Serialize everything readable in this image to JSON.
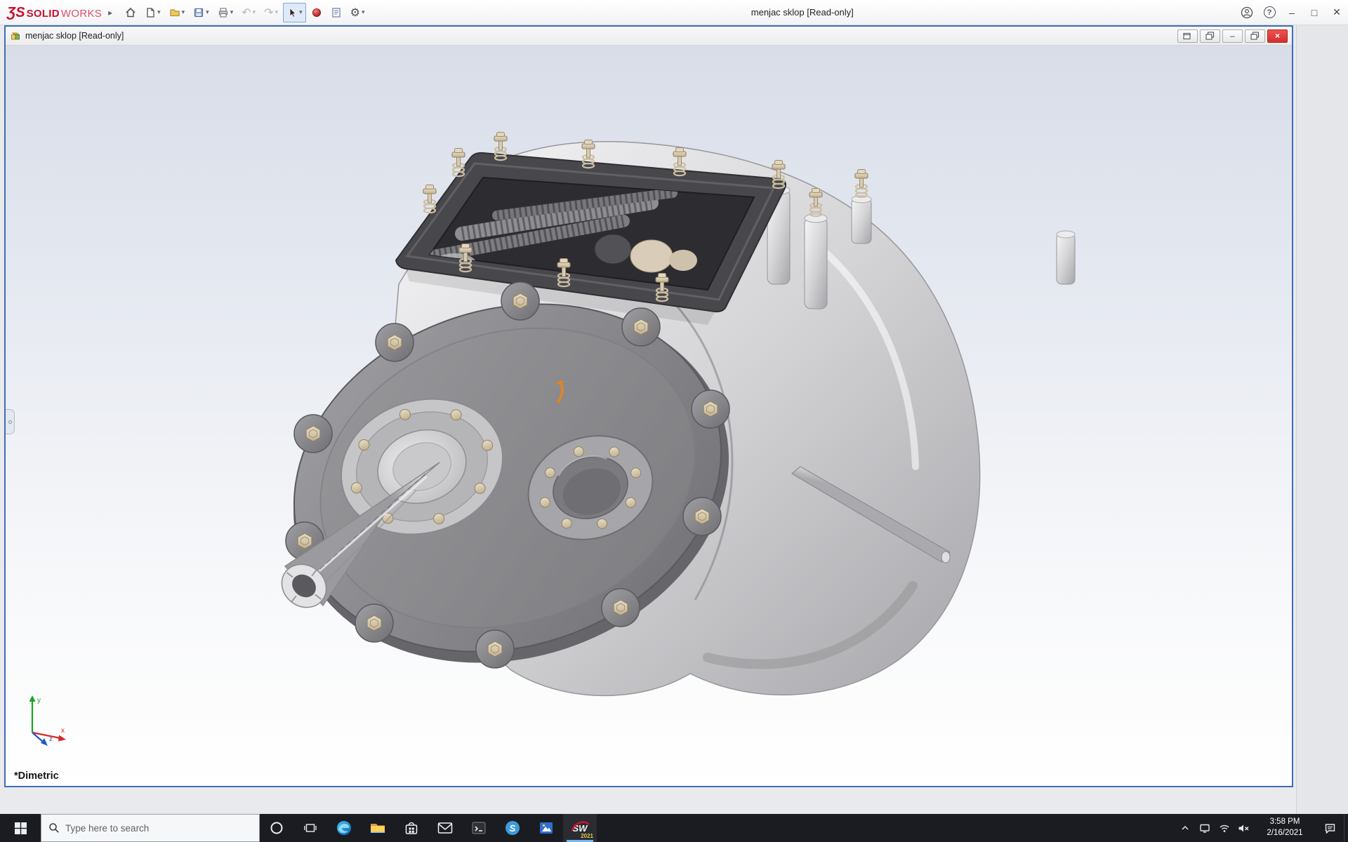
{
  "app_titlebar": {
    "logo_mark": "ƷS",
    "logo_solid": "SOLID",
    "logo_works": "WORKS",
    "title": "menjac sklop [Read-only]",
    "glyphs": {
      "expander": "▸",
      "caret": "▾",
      "undo": "↶",
      "redo": "↷",
      "gear": "⚙",
      "help": "?",
      "minimize": "–",
      "maximize": "□",
      "close": "×"
    }
  },
  "document_window": {
    "title": "menjac sklop [Read-only]",
    "glyphs": {
      "minimize": "–",
      "close": "×"
    }
  },
  "viewport": {
    "view_orientation_label": "*Dimetric",
    "triad": {
      "x_label": "x",
      "y_label": "y",
      "z_label": "z"
    }
  },
  "taskbar": {
    "search_placeholder": "Type here to search",
    "solidworks_icon_text": "SW",
    "solidworks_badge": "2021",
    "clock_time": "3:58 PM",
    "clock_date": "2/16/2021"
  },
  "colors": {
    "document_border_blue": "#3f6db5",
    "close_button_red": "#d32f2f",
    "viewport_gradient_top": "#d8dde8",
    "viewport_gradient_bottom": "#ffffff",
    "taskbar_background": "#1b1c22",
    "solidworks_logo_red": "#c8102e",
    "bolt_tan": "#d5c8ae",
    "flange_gray": "#8a8a8d",
    "gasket_dark_gray": "#48484c",
    "sketch_orange": "#e8821e",
    "active_tool_highlight": "#dfe9f7"
  }
}
